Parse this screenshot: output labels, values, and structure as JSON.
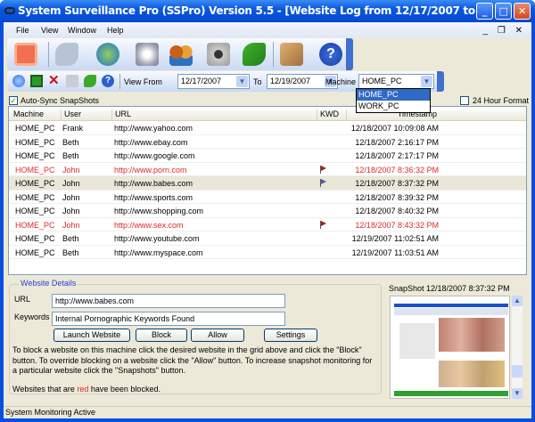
{
  "window": {
    "title": "System Surveillance Pro (SSPro) Version 5.5 - [Website Log from 12/17/2007 to 12/19/2007]",
    "minimize": "_",
    "maximize": "□",
    "close": "✕"
  },
  "menu": [
    "File",
    "View",
    "Window",
    "Help"
  ],
  "mdi_controls": "_ ❐ ✕",
  "main_toolbar": {
    "icons": [
      "screen-icon",
      "keyboard-icon",
      "internet-explorer-icon",
      "disk-icon",
      "users-icon",
      "camera-icon",
      "sync-icon",
      "keys-icon",
      "help-icon"
    ]
  },
  "filter_toolbar": {
    "icons": [
      "check-icon",
      "save-icon",
      "delete-icon",
      "print-icon",
      "sync-icon",
      "help-icon"
    ],
    "view_from_label": "View From",
    "from_date": "12/17/2007",
    "to_label": "To",
    "to_date": "12/19/2007",
    "machine_label": "Machine",
    "machine_value": "HOME_PC",
    "machine_options": [
      "HOME_PC",
      "WORK_PC"
    ]
  },
  "auto_sync": {
    "label": "Auto-Sync SnapShots",
    "checked": true
  },
  "hour_format": {
    "label": "24 Hour Format",
    "checked": false
  },
  "grid": {
    "columns": [
      "Machine",
      "User",
      "URL",
      "KWD",
      "Timestamp"
    ],
    "rows": [
      {
        "machine": "HOME_PC",
        "user": "Frank",
        "url": "http://www.yahoo.com",
        "kwd": "",
        "timestamp": "12/18/2007  10:09:08 AM",
        "blocked": false
      },
      {
        "machine": "HOME_PC",
        "user": "Beth",
        "url": "http://www.ebay.com",
        "kwd": "",
        "timestamp": "12/18/2007  2:16:17 PM",
        "blocked": false
      },
      {
        "machine": "HOME_PC",
        "user": "Beth",
        "url": "http://www.google.com",
        "kwd": "",
        "timestamp": "12/18/2007  2:17:17 PM",
        "blocked": false
      },
      {
        "machine": "HOME_PC",
        "user": "John",
        "url": "http://www.porn.com",
        "kwd": "red-flag",
        "timestamp": "12/18/2007  8:36:32 PM",
        "blocked": true
      },
      {
        "machine": "HOME_PC",
        "user": "John",
        "url": "http://www.babes.com",
        "kwd": "blue-flag",
        "timestamp": "12/18/2007  8:37:32 PM",
        "blocked": false,
        "selected": true
      },
      {
        "machine": "HOME_PC",
        "user": "John",
        "url": "http://www.sports.com",
        "kwd": "",
        "timestamp": "12/18/2007  8:39:32 PM",
        "blocked": false
      },
      {
        "machine": "HOME_PC",
        "user": "John",
        "url": "http://www.shopping.com",
        "kwd": "",
        "timestamp": "12/18/2007  8:40:32 PM",
        "blocked": false
      },
      {
        "machine": "HOME_PC",
        "user": "John",
        "url": "http://www.sex.com",
        "kwd": "red-flag",
        "timestamp": "12/18/2007  8:43:32 PM",
        "blocked": true
      },
      {
        "machine": "HOME_PC",
        "user": "Beth",
        "url": "http://www.youtube.com",
        "kwd": "",
        "timestamp": "12/19/2007  11:02:51 AM",
        "blocked": false
      },
      {
        "machine": "HOME_PC",
        "user": "Beth",
        "url": "http://www.myspace.com",
        "kwd": "",
        "timestamp": "12/19/2007  11:03:51 AM",
        "blocked": false
      }
    ]
  },
  "details": {
    "title": "Website Details",
    "url_label": "URL",
    "url_value": "http://www.babes.com",
    "keywords_label": "Keywords",
    "keywords_value": "Internal Pornographic Keywords Found",
    "buttons": {
      "launch": "Launch Website",
      "block": "Block",
      "allow": "Allow",
      "settings": "Settings"
    },
    "help_text": "To block a website on this machine click the desired website in the grid above and click the \"Block\" button. To override blocking on a website click the \"Allow\" button. To increase snapshot monitoring for a particular website click the \"Snapshots\" button.",
    "note_prefix": "Websites that are ",
    "note_red": "red",
    "note_suffix": " have been blocked."
  },
  "snapshot": {
    "label": "SnapShot 12/18/2007 8:37:32 PM"
  },
  "status": "System Monitoring Active",
  "colors": {
    "title_bar": "#0a58e0",
    "blocked": "#e02828",
    "selected_row": "#eae6d8",
    "group_title": "#2b3ed4"
  }
}
